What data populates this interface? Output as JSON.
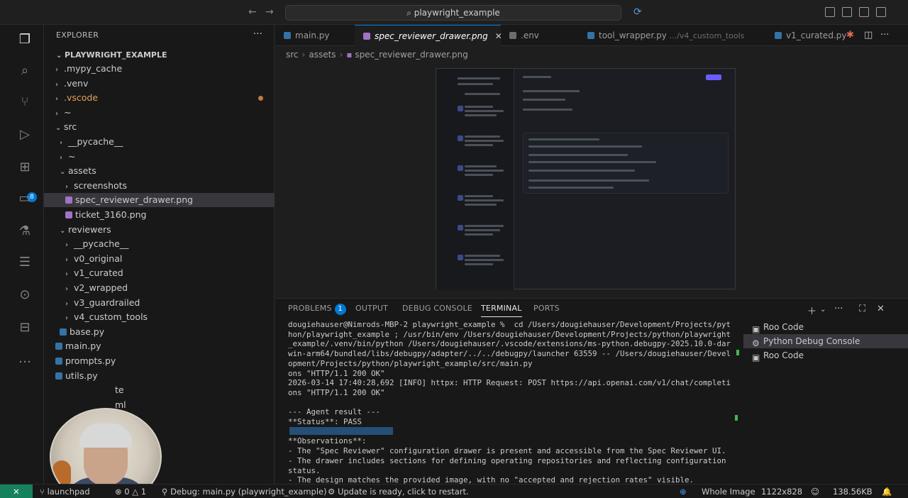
{
  "titlebar": {
    "command_center": "playwright_example",
    "back_icon": "arrow-left-icon",
    "forward_icon": "arrow-right-icon"
  },
  "activity_bar": {
    "items": [
      "explorer-icon",
      "search-icon",
      "source-control-icon",
      "run-debug-icon",
      "extensions-icon",
      "remote-explorer-icon",
      "testing-icon",
      "database-icon",
      "git-graph-icon",
      "docker-icon"
    ],
    "extensions_badge": "8"
  },
  "explorer": {
    "title": "EXPLORER",
    "root": "PLAYWRIGHT_EXAMPLE",
    "items": [
      {
        "label": ".mypy_cache",
        "chev": "›"
      },
      {
        "label": ".venv",
        "chev": "›"
      },
      {
        "label": ".vscode",
        "chev": "›"
      },
      {
        "label": "~",
        "chev": "›"
      },
      {
        "label": "src",
        "chev": "⌄"
      },
      {
        "label": "__pycache__",
        "chev": "›"
      },
      {
        "label": "~",
        "chev": "›"
      },
      {
        "label": "assets",
        "chev": "⌄"
      },
      {
        "label": "screenshots",
        "chev": "›"
      },
      {
        "label": "spec_reviewer_drawer.png"
      },
      {
        "label": "ticket_3160.png"
      },
      {
        "label": "reviewers",
        "chev": "⌄"
      },
      {
        "label": "__pycache__",
        "chev": "›"
      },
      {
        "label": "v0_original",
        "chev": "›"
      },
      {
        "label": "v1_curated",
        "chev": "›"
      },
      {
        "label": "v2_wrapped",
        "chev": "›"
      },
      {
        "label": "v3_guardrailed",
        "chev": "›"
      },
      {
        "label": "v4_custom_tools",
        "chev": "›"
      },
      {
        "label": "base.py"
      },
      {
        "label": "main.py"
      },
      {
        "label": "prompts.py"
      },
      {
        "label": "utils.py"
      },
      {
        "label": "te"
      },
      {
        "label": "ml"
      }
    ]
  },
  "tabs": [
    {
      "label": "main.py",
      "desc": ""
    },
    {
      "label": "spec_reviewer_drawer.png",
      "desc": "",
      "close": "✕"
    },
    {
      "label": ".env",
      "desc": ""
    },
    {
      "label": "tool_wrapper.py",
      "desc": ".../v4_custom_tools"
    },
    {
      "label": "v1_curated.py",
      "desc": ""
    }
  ],
  "breadcrumb": [
    "src",
    "assets",
    "spec_reviewer_drawer.png"
  ],
  "panel": {
    "tabs": [
      "PROBLEMS",
      "OUTPUT",
      "DEBUG CONSOLE",
      "TERMINAL",
      "PORTS"
    ],
    "problems_count": "1",
    "terminal_text": "dougiehauser@Nimrods-MBP-2 playwright_example %  cd /Users/dougiehauser/Development/Projects/pyt\nhon/playwright_example ; /usr/bin/env /Users/dougiehauser/Development/Projects/python/playwright\n_example/.venv/bin/python /Users/dougiehauser/.vscode/extensions/ms-python.debugpy-2025.10.0-dar\nwin-arm64/bundled/libs/debugpy/adapter/../../debugpy/launcher 63559 -- /Users/dougiehauser/Devel\nopment/Projects/python/playwright_example/src/main.py\nons \"HTTP/1.1 200 OK\"\n2026-03-14 17:40:28,692 [INFO] httpx: HTTP Request: POST https://api.openai.com/v1/chat/completi\nons \"HTTP/1.1 200 OK\"\n\n--- Agent result ---\n**Status**: PASS\n\n**Observations**:\n- The \"Spec Reviewer\" configuration drawer is present and accessible from the Spec Reviewer UI.\n- The drawer includes sections for defining operating repositories and reflecting configuration\nstatus.\n- The design matches the provided image, with no \"accepted and rejection rates\" visible.",
    "terminals": [
      "Roo Code",
      "Python Debug Console",
      "Roo Code"
    ]
  },
  "statusbar": {
    "remote": "✕",
    "branch": "launchpad",
    "errors": "0",
    "warnings": "1",
    "debug": "Debug: main.py (playwright_example)",
    "update": "Update is ready, click to restart.",
    "image_mode": "Whole Image",
    "dimensions": "1122x828",
    "size": "138.56KB"
  }
}
